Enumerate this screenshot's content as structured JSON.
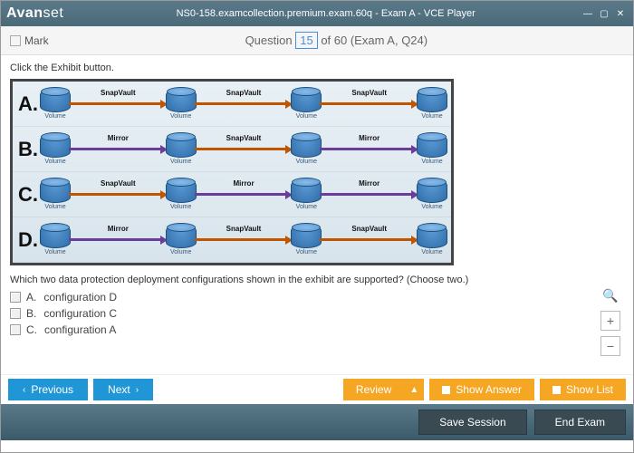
{
  "window": {
    "logo_part1": "Avan",
    "logo_part2": "set",
    "title": "NS0-158.examcollection.premium.exam.60q - Exam A - VCE Player",
    "minimize": "—",
    "maximize": "▢",
    "close": "✕"
  },
  "header": {
    "mark_label": "Mark",
    "q_word": "Question",
    "q_number": "15",
    "q_rest": " of 60 (Exam A, Q24)"
  },
  "question": {
    "prompt": "Click the Exhibit button.",
    "text": "Which two data protection deployment configurations shown in the exhibit are supported? (Choose two.)"
  },
  "exhibit": {
    "vol_label": "Volume",
    "snapvault": "SnapVault",
    "mirror": "Mirror",
    "rows": [
      {
        "label": "A.",
        "arrows": [
          "sv",
          "sv",
          "sv"
        ]
      },
      {
        "label": "B.",
        "arrows": [
          "mr",
          "sv",
          "mr"
        ]
      },
      {
        "label": "C.",
        "arrows": [
          "sv",
          "mr",
          "mr"
        ]
      },
      {
        "label": "D.",
        "arrows": [
          "mr",
          "sv",
          "sv"
        ]
      }
    ]
  },
  "answers": [
    {
      "letter": "A.",
      "text": "configuration D"
    },
    {
      "letter": "B.",
      "text": "configuration C"
    },
    {
      "letter": "C.",
      "text": "configuration A"
    }
  ],
  "nav": {
    "previous": "Previous",
    "next": "Next",
    "review": "Review",
    "show_answer": "Show Answer",
    "show_list": "Show List",
    "chev_left": "‹",
    "chev_right": "›",
    "tri_up": "▲"
  },
  "bottom": {
    "save_session": "Save Session",
    "end_exam": "End Exam"
  },
  "side": {
    "magnify": "🔍",
    "plus": "+",
    "minus": "−"
  }
}
